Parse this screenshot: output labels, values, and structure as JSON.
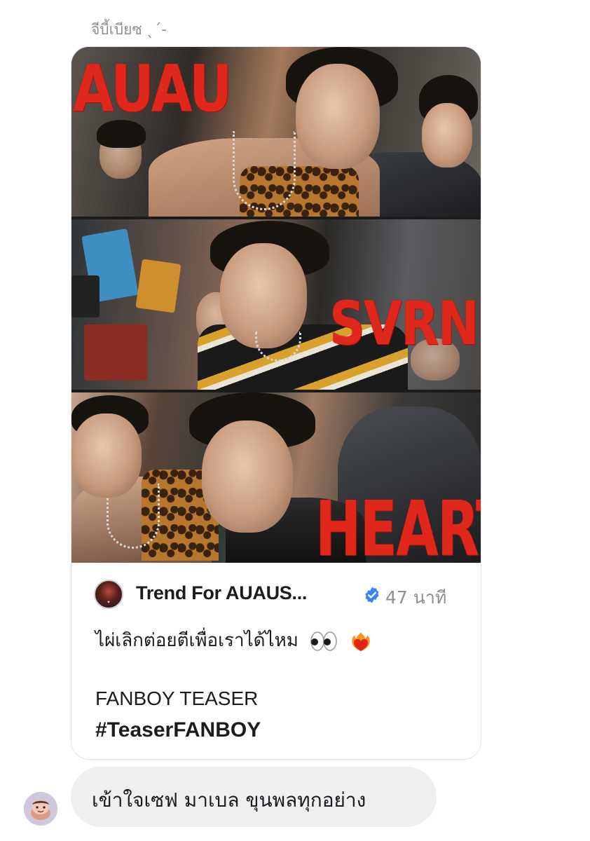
{
  "sender": {
    "name": "จีบี้เบียซ ˎˊ-"
  },
  "shared_post": {
    "collage": {
      "panel_1_title": "AUAU",
      "panel_2_title": "SVRN",
      "panel_3_title": "HEART"
    },
    "account_name": "Trend For AUAUS...",
    "verified_icon": "verified-badge-icon",
    "time_ago": "47 นาที",
    "caption_line_1": "ไผ่เลิกต่อยตีเพื่อเราได้ไหม",
    "caption_emojis": [
      "eyes-emoji",
      "heart-on-fire-emoji"
    ],
    "caption_line_2": "FANBOY TEASER",
    "hashtag": "#TeaserFANBOY"
  },
  "reply": {
    "text": "เข้าใจเซฟ มาเบล ขุนพลทุกอย่าง",
    "avatar_icon": "cartoon-character-avatar"
  },
  "colors": {
    "verified_blue": "#3b82f6",
    "bubble_gray": "#efeff2",
    "sticker_red": "#e0271c",
    "secondary_text": "#8e8e93"
  }
}
